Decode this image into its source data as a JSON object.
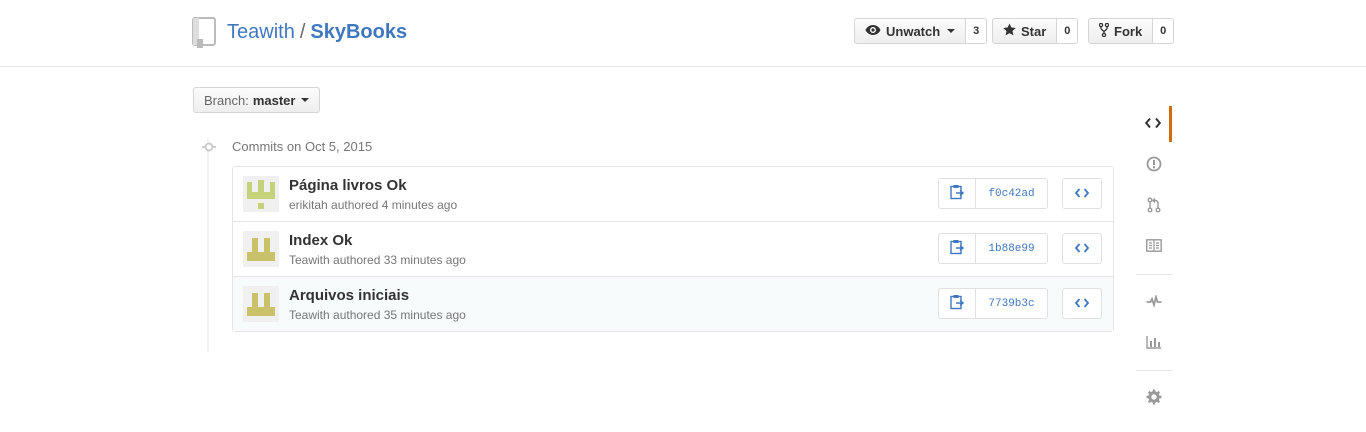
{
  "header": {
    "owner": "Teawith",
    "separator": "/",
    "repo": "SkyBooks",
    "watch": {
      "label": "Unwatch",
      "count": "3"
    },
    "star": {
      "label": "Star",
      "count": "0"
    },
    "fork": {
      "label": "Fork",
      "count": "0"
    }
  },
  "branch": {
    "label": "Branch:",
    "value": "master"
  },
  "commits_heading": "Commits on Oct 5, 2015",
  "commits": [
    {
      "message": "Página livros Ok",
      "author": "erikitah",
      "action": "authored",
      "time": "4 minutes ago",
      "sha": "f0c42ad"
    },
    {
      "message": "Index Ok",
      "author": "Teawith",
      "action": "authored",
      "time": "33 minutes ago",
      "sha": "1b88e99"
    },
    {
      "message": "Arquivos iniciais",
      "author": "Teawith",
      "action": "authored",
      "time": "35 minutes ago",
      "sha": "7739b3c"
    }
  ],
  "sidebar": [
    "code-icon",
    "issues-icon",
    "pull-requests-icon",
    "wiki-icon",
    "pulse-icon",
    "graphs-icon",
    "settings-icon"
  ],
  "colors": {
    "link": "#4078c0",
    "accent": "#d26911",
    "avatar_green": "#c5d27a",
    "avatar_olive": "#c9c26a"
  }
}
